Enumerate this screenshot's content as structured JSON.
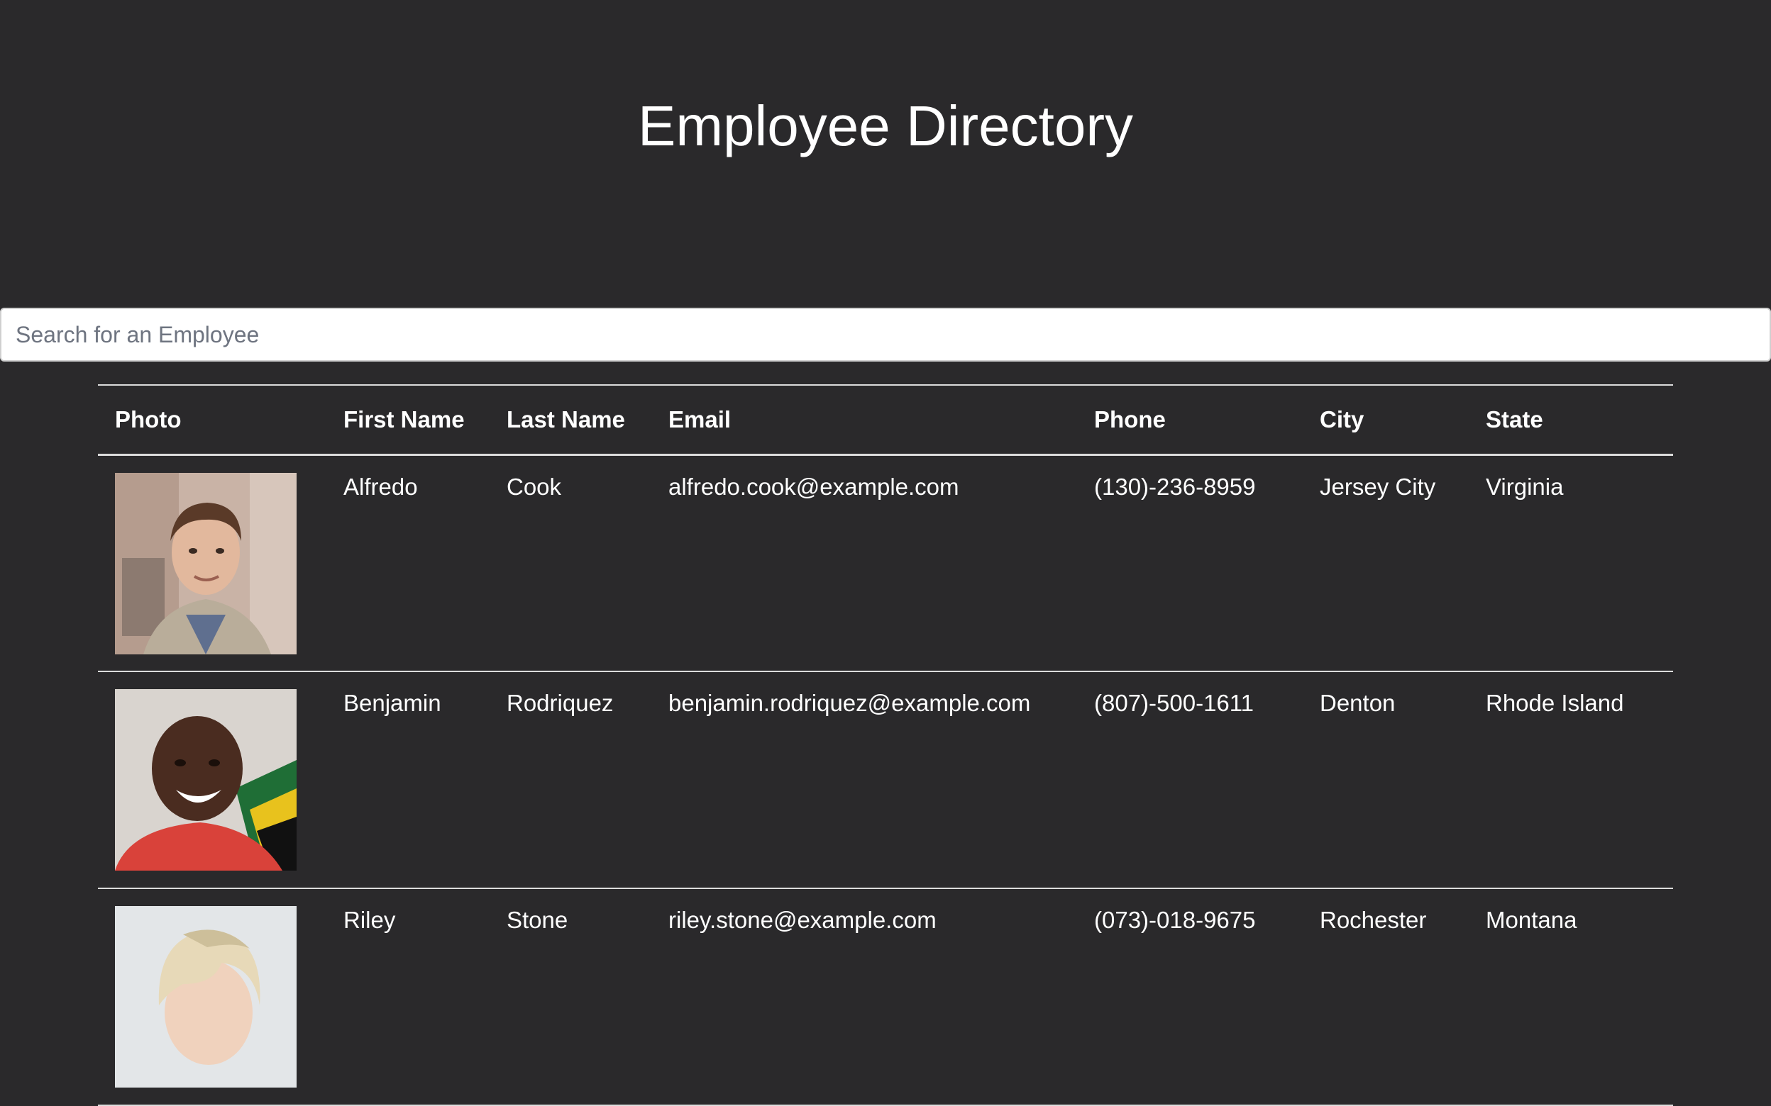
{
  "header": {
    "title": "Employee Directory"
  },
  "search": {
    "placeholder": "Search for an Employee",
    "value": ""
  },
  "table": {
    "columns": [
      "Photo",
      "First Name",
      "Last Name",
      "Email",
      "Phone",
      "City",
      "State"
    ],
    "rows": [
      {
        "photo_icon": "employee-photo-man-beige-coat",
        "first": "Alfredo",
        "last": "Cook",
        "email": "alfredo.cook@example.com",
        "phone": "(130)-236-8959",
        "city": "Jersey City",
        "state": "Virginia"
      },
      {
        "photo_icon": "employee-photo-man-red-shirt",
        "first": "Benjamin",
        "last": "Rodriquez",
        "email": "benjamin.rodriquez@example.com",
        "phone": "(807)-500-1611",
        "city": "Denton",
        "state": "Rhode Island"
      },
      {
        "photo_icon": "employee-photo-woman-blonde",
        "first": "Riley",
        "last": "Stone",
        "email": "riley.stone@example.com",
        "phone": "(073)-018-9675",
        "city": "Rochester",
        "state": "Montana"
      }
    ]
  },
  "colors": {
    "background": "#2a292b",
    "text": "#ffffff",
    "divider": "#dcdcdc",
    "search_bg": "#ffffff"
  }
}
